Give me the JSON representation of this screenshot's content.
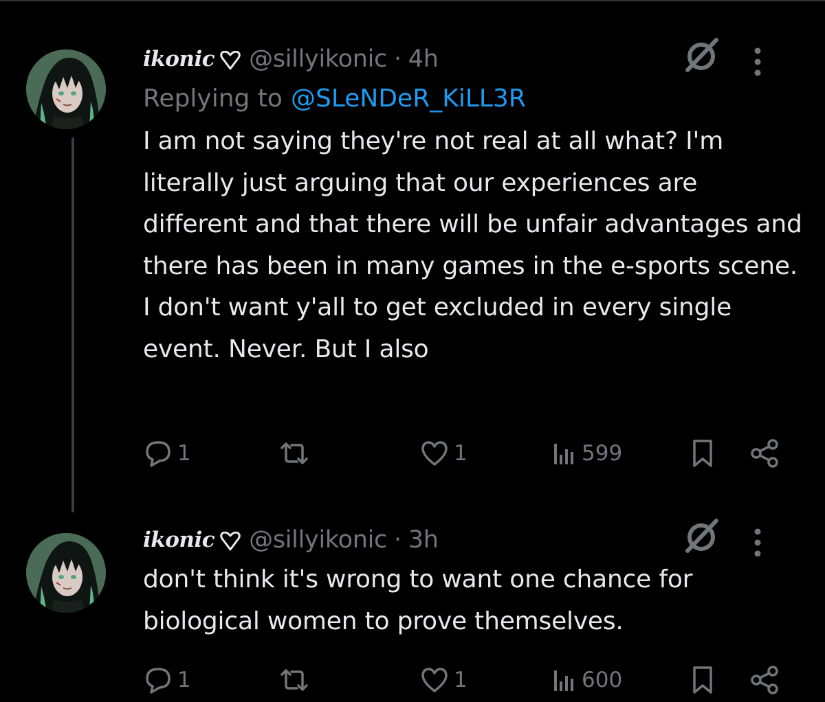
{
  "colors": {
    "background": "#000000",
    "text_primary": "#e7e9ea",
    "text_secondary": "#71767b",
    "link": "#1d9bf0",
    "thread_line": "#3a3d41"
  },
  "tweets": [
    {
      "display_name": "ikonic",
      "name_badge_icon": "heart-outline-icon",
      "handle": "@sillyikonic",
      "separator": "·",
      "time": "4h",
      "reply_prefix": "Replying to",
      "reply_target": "@SLeNDeR_KiLL3R",
      "text": "I am not saying they're not real at all what? I'm literally just arguing that our experiences are different and that there will be unfair advantages and there has been in many games in the e-sports scene. I don't want y'all to get excluded in every single event. Never. But I also",
      "actions": {
        "replies": "1",
        "reposts": "",
        "likes": "1",
        "views": "599"
      }
    },
    {
      "display_name": "ikonic",
      "name_badge_icon": "heart-outline-icon",
      "handle": "@sillyikonic",
      "separator": "·",
      "time": "3h",
      "text": "don't think it's wrong to want one chance for biological women to prove themselves.",
      "actions": {
        "replies": "1",
        "reposts": "",
        "likes": "1",
        "views": "600"
      }
    }
  ],
  "icons": {
    "grok": "grok-icon",
    "more": "more-options-icon",
    "reply": "reply-bubble-icon",
    "repost": "repost-icon",
    "like": "heart-icon",
    "views": "views-bars-icon",
    "bookmark": "bookmark-icon",
    "share": "share-icon"
  }
}
